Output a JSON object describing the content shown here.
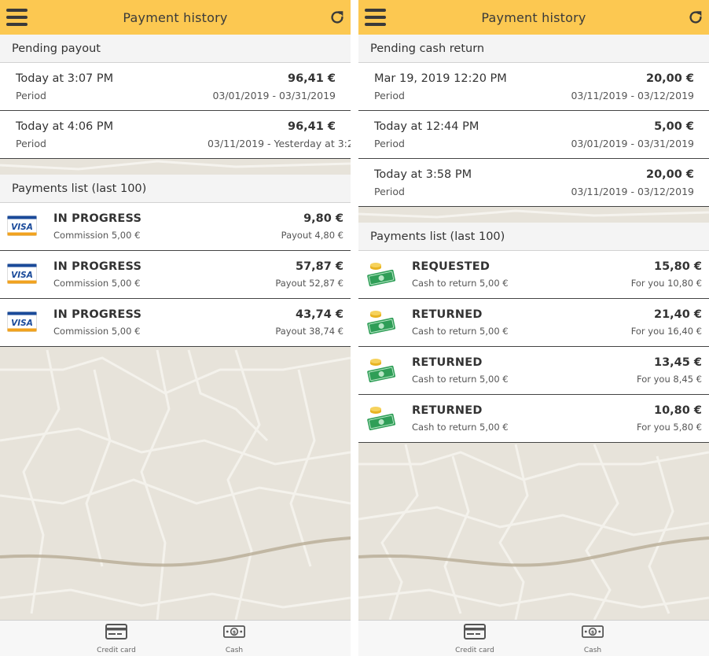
{
  "colors": {
    "header": "#fcc851",
    "visa_blue": "#1a4a9a",
    "visa_orange": "#f1a21e",
    "cash_green": "#2f9e57",
    "coin_gold": "#e8b321"
  },
  "icons": {
    "menu": "hamburger-menu-icon",
    "refresh": "refresh-icon",
    "visa": "visa-card-icon",
    "cash": "cash-money-icon",
    "credit_card_tab": "credit-card-icon",
    "cash_tab": "cash-bill-icon"
  },
  "left": {
    "header": {
      "title": "Payment history"
    },
    "pending": {
      "title": "Pending payout",
      "items": [
        {
          "date": "Today at 3:07 PM",
          "label": "Period",
          "amount": "96,41 €",
          "period": "03/01/2019 - 03/31/2019"
        },
        {
          "date": "Today at 4:06 PM",
          "label": "Period",
          "amount": "96,41 €",
          "period": "03/11/2019 - Yesterday at 3:2"
        }
      ]
    },
    "payments": {
      "title": "Payments list (last 100)",
      "items": [
        {
          "status": "IN PROGRESS",
          "sub": "Commission 5,00 €",
          "amount": "9,80 €",
          "sub_right": "Payout 4,80 €",
          "visa_text": "VISA"
        },
        {
          "status": "IN PROGRESS",
          "sub": "Commission 5,00 €",
          "amount": "57,87 €",
          "sub_right": "Payout 52,87 €",
          "visa_text": "VISA"
        },
        {
          "status": "IN PROGRESS",
          "sub": "Commission 5,00 €",
          "amount": "43,74 €",
          "sub_right": "Payout 38,74 €",
          "visa_text": "VISA"
        }
      ]
    },
    "tabs": {
      "credit_card": "Credit card",
      "cash": "Cash"
    }
  },
  "right": {
    "header": {
      "title": "Payment history"
    },
    "pending": {
      "title": "Pending cash return",
      "items": [
        {
          "date": "Mar 19, 2019 12:20 PM",
          "label": "Period",
          "amount": "20,00 €",
          "period": "03/11/2019 - 03/12/2019"
        },
        {
          "date": "Today at 12:44 PM",
          "label": "Period",
          "amount": "5,00 €",
          "period": "03/01/2019 - 03/31/2019"
        },
        {
          "date": "Today at 3:58 PM",
          "label": "Period",
          "amount": "20,00 €",
          "period": "03/11/2019 - 03/12/2019"
        }
      ]
    },
    "payments": {
      "title": "Payments list (last 100)",
      "items": [
        {
          "status": "REQUESTED",
          "sub": "Cash to return 5,00 €",
          "amount": "15,80 €",
          "sub_right": "For you 10,80 €"
        },
        {
          "status": "RETURNED",
          "sub": "Cash to return 5,00 €",
          "amount": "21,40 €",
          "sub_right": "For you 16,40 €"
        },
        {
          "status": "RETURNED",
          "sub": "Cash to return 5,00 €",
          "amount": "13,45 €",
          "sub_right": "For you 8,45 €"
        },
        {
          "status": "RETURNED",
          "sub": "Cash to return 5,00 €",
          "amount": "10,80 €",
          "sub_right": "For you 5,80 €"
        }
      ]
    },
    "tabs": {
      "credit_card": "Credit card",
      "cash": "Cash"
    }
  }
}
